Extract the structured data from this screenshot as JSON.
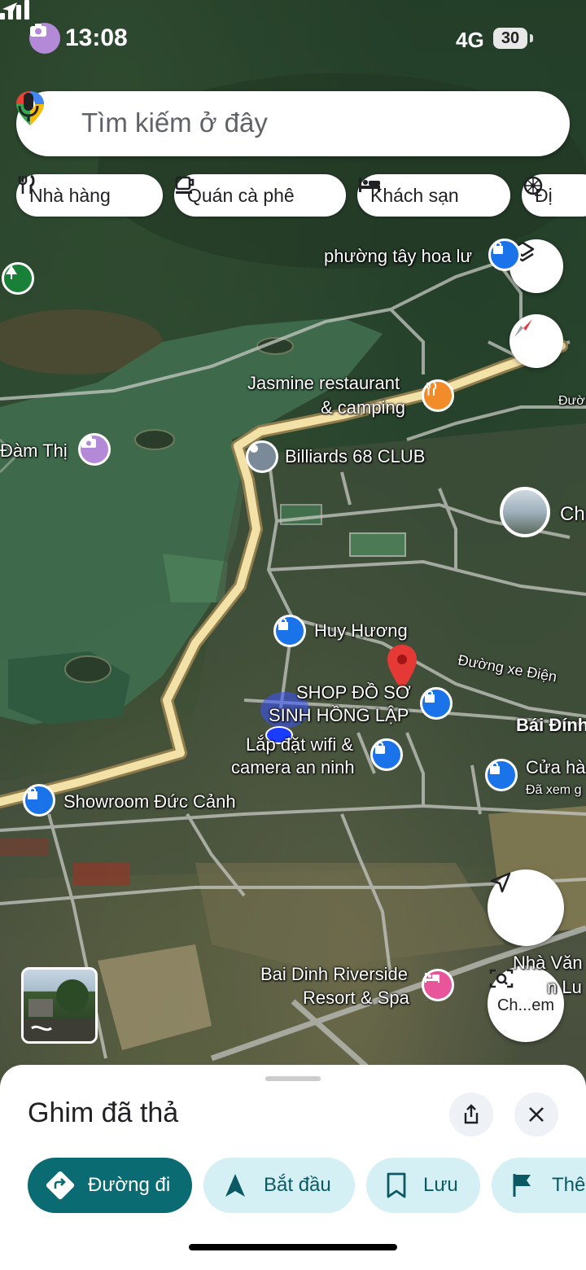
{
  "status_bar": {
    "time": "13:08",
    "network": "4G",
    "battery": "30"
  },
  "search": {
    "placeholder": "Tìm kiếm ở đây"
  },
  "chips": [
    {
      "label": "Nhà hàng",
      "icon": "fork-knife-icon"
    },
    {
      "label": "Quán cà phê",
      "icon": "coffee-cup-icon"
    },
    {
      "label": "Khách sạn",
      "icon": "bed-icon"
    },
    {
      "label": "Đị",
      "icon": "attraction-icon"
    }
  ],
  "map_labels": {
    "phuong": "phường tây hoa lư",
    "jasmine_1": "Jasmine restaurant",
    "jasmine_2": "& camping",
    "dam_thi": "Đàm Thị",
    "billiards": "Billiards 68 CLUB",
    "ch_right": "Ch",
    "huy_huong": "Huy Hương",
    "duong_xe_dien": "Đường xe Điện",
    "shop_1": "SHOP ĐỒ SƠ",
    "shop_2": "SINH HỒNG LẬP",
    "bai_dinh": "Bái Đính",
    "wifi_1": "Lắp đặt wifi &",
    "wifi_2": "camera an ninh",
    "cua_ha": "Cửa hà",
    "da_xem": "Đã xem g",
    "showroom": "Showroom Đức Cảnh",
    "nha_van_1": "Nhà Văn",
    "nha_van_2": "n Lu",
    "riverside_1": "Bai Dinh Riverside",
    "riverside_2": "Resort & Spa",
    "duong_top": "Đườ",
    "ch_em": "Ch...em"
  },
  "sheet": {
    "title": "Ghim đã thả",
    "actions": [
      {
        "label": "Đường đi",
        "icon": "directions-icon"
      },
      {
        "label": "Bắt đầu",
        "icon": "navigation-arrow-icon"
      },
      {
        "label": "Lưu",
        "icon": "bookmark-icon"
      },
      {
        "label": "Thê",
        "icon": "flag-icon"
      }
    ]
  },
  "colors": {
    "accent": "#0b6b73",
    "secondary_bg": "#d4f0f5",
    "pin_red": "#e53935",
    "shop_pin": "#1a73e8",
    "food_pin": "#f28b2a",
    "photo_pin": "#b48ad8",
    "park_pin": "#188038",
    "hotel_pin": "#e8559b",
    "road_main": "#f3e2a8"
  }
}
